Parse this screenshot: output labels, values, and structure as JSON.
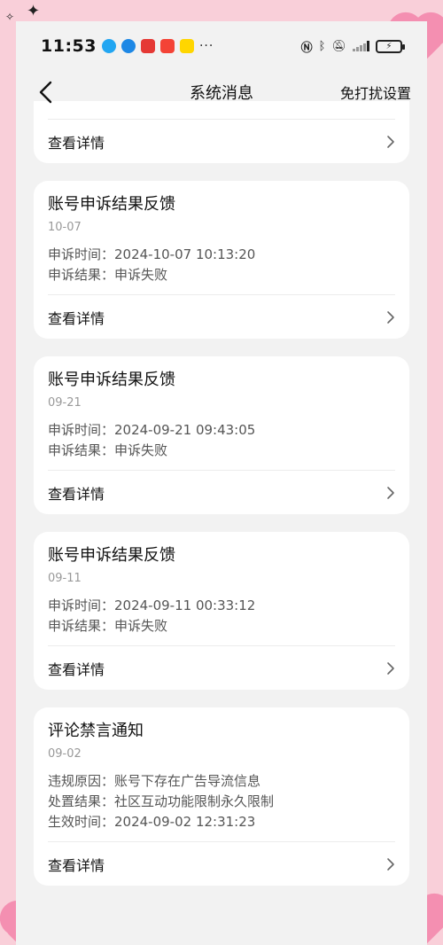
{
  "status_bar": {
    "time": "11:53",
    "app_icons": [
      {
        "name": "notification-app-icon-1",
        "color": "#22a6f2"
      },
      {
        "name": "notification-app-icon-2",
        "color": "#1e88e5"
      },
      {
        "name": "notification-app-icon-3",
        "color": "#e53935"
      },
      {
        "name": "notification-app-icon-4",
        "color": "#f44336"
      },
      {
        "name": "notification-app-icon-5",
        "color": "#ffd600"
      }
    ],
    "more": "···",
    "battery": "⚡"
  },
  "nav": {
    "title": "系统消息",
    "action": "免打扰设置"
  },
  "cards": [
    {
      "detail_label": "查看详情"
    },
    {
      "title": "账号申诉结果反馈",
      "date": "10-07",
      "lines": [
        "申诉时间：2024-10-07 10:13:20",
        "申诉结果：申诉失败"
      ],
      "detail_label": "查看详情"
    },
    {
      "title": "账号申诉结果反馈",
      "date": "09-21",
      "lines": [
        "申诉时间：2024-09-21 09:43:05",
        "申诉结果：申诉失败"
      ],
      "detail_label": "查看详情"
    },
    {
      "title": "账号申诉结果反馈",
      "date": "09-11",
      "lines": [
        "申诉时间：2024-09-11 00:33:12",
        "申诉结果：申诉失败"
      ],
      "detail_label": "查看详情"
    },
    {
      "title": "评论禁言通知",
      "date": "09-02",
      "lines": [
        "违规原因：账号下存在广告导流信息",
        "处置结果：社区互动功能限制永久限制",
        "生效时间：2024-09-02 12:31:23"
      ],
      "detail_label": "查看详情"
    }
  ],
  "colors": {
    "background_pink": "#f9cfd9",
    "page_gray": "#f2f2f2",
    "card_white": "#ffffff"
  }
}
